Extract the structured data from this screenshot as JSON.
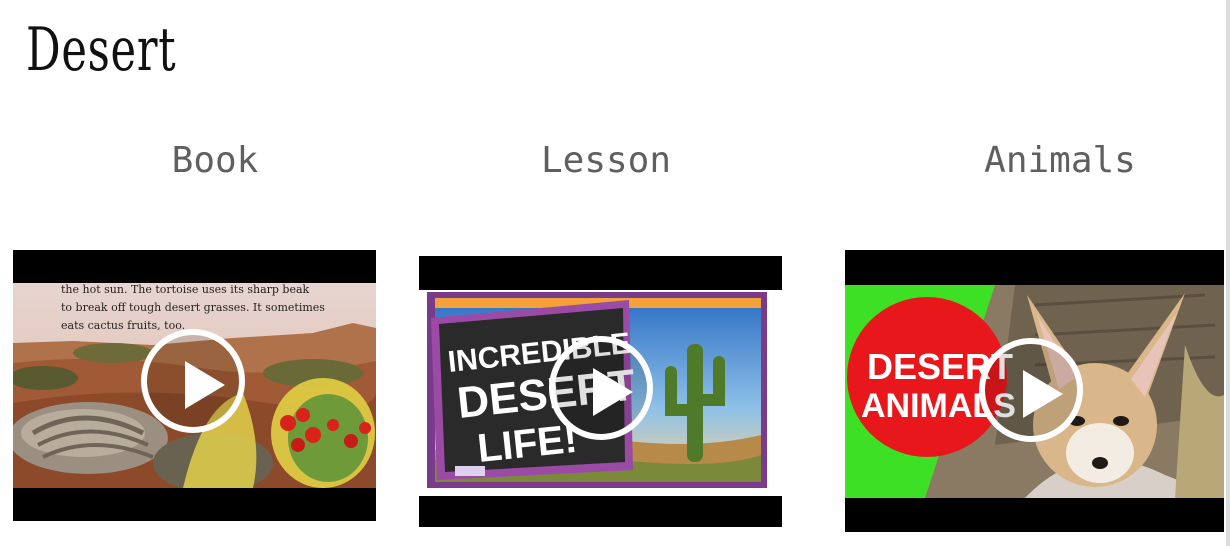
{
  "page": {
    "title": "Desert"
  },
  "videos": [
    {
      "label": "Book",
      "thumb_text": [
        "the hot sun. The tortoise uses its sharp beak",
        "to break off tough desert grasses. It sometimes",
        "eats cactus fruits, too."
      ]
    },
    {
      "label": "Lesson",
      "thumb_sign": [
        "INCREDIBLE",
        "DESERT",
        "LIFE!"
      ]
    },
    {
      "label": "Animals",
      "thumb_badge": [
        "DESERT",
        "ANIMALS"
      ]
    }
  ],
  "colors": {
    "title": "#111111",
    "label": "#5f5f5f",
    "letterbox": "#000000",
    "badge_red": "#e8171c",
    "badge_green": "#3ee025",
    "sign_purple": "#6b3a8f"
  }
}
